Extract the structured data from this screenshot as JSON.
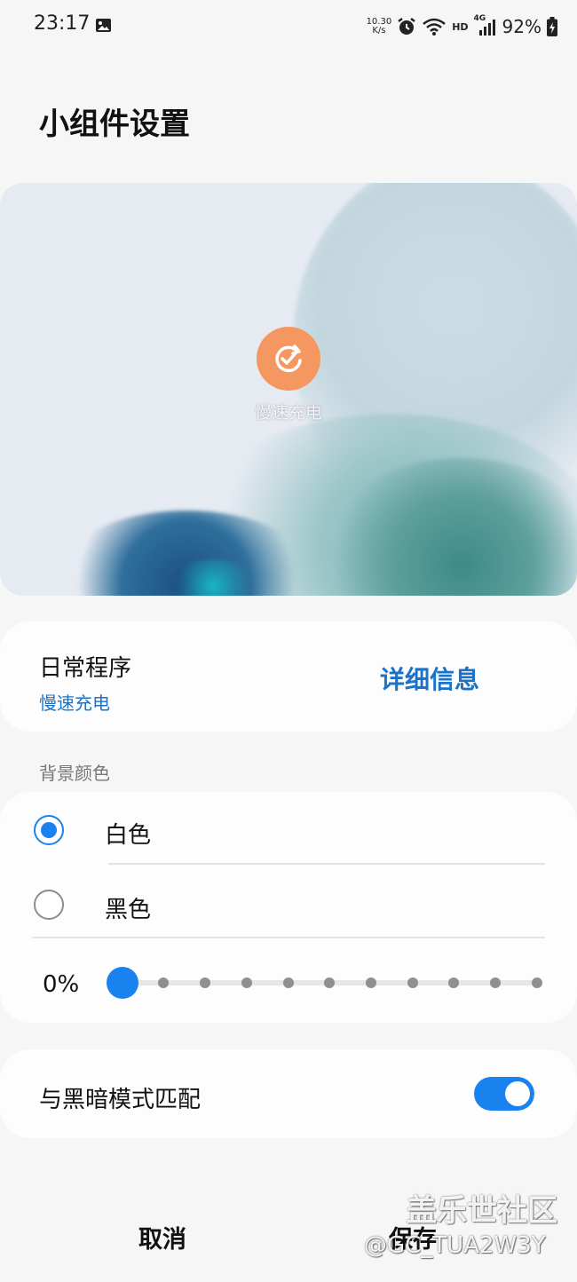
{
  "status_bar": {
    "time": "23:17",
    "net_speed_value": "10.30",
    "net_speed_unit": "K/s",
    "hd_badge": "HD",
    "cell_label": "4G",
    "battery": "92%",
    "icons": [
      "gallery-icon",
      "alarm-icon",
      "wifi-icon",
      "signal-icon",
      "battery-charging-icon"
    ]
  },
  "page": {
    "title": "小组件设置"
  },
  "preview": {
    "widget_label": "慢速充电",
    "widget_icon": "refresh-check-icon",
    "widget_color": "#f49760"
  },
  "routine_card": {
    "title": "日常程序",
    "subtitle": "慢速充电",
    "details_link": "详细信息",
    "accent": "#1b73c8"
  },
  "background_color": {
    "section_label": "背景颜色",
    "options": [
      {
        "label": "白色",
        "selected": true
      },
      {
        "label": "黑色",
        "selected": false
      }
    ],
    "transparency_value": "0%",
    "transparency_fraction": 0,
    "accent": "#1a82ee"
  },
  "dark_mode": {
    "label": "与黑暗模式匹配",
    "enabled": true
  },
  "footer": {
    "cancel": "取消",
    "save": "保存"
  },
  "watermark": {
    "line1": "盖乐世社区",
    "line2": "@GC_TUA2W3Y"
  }
}
